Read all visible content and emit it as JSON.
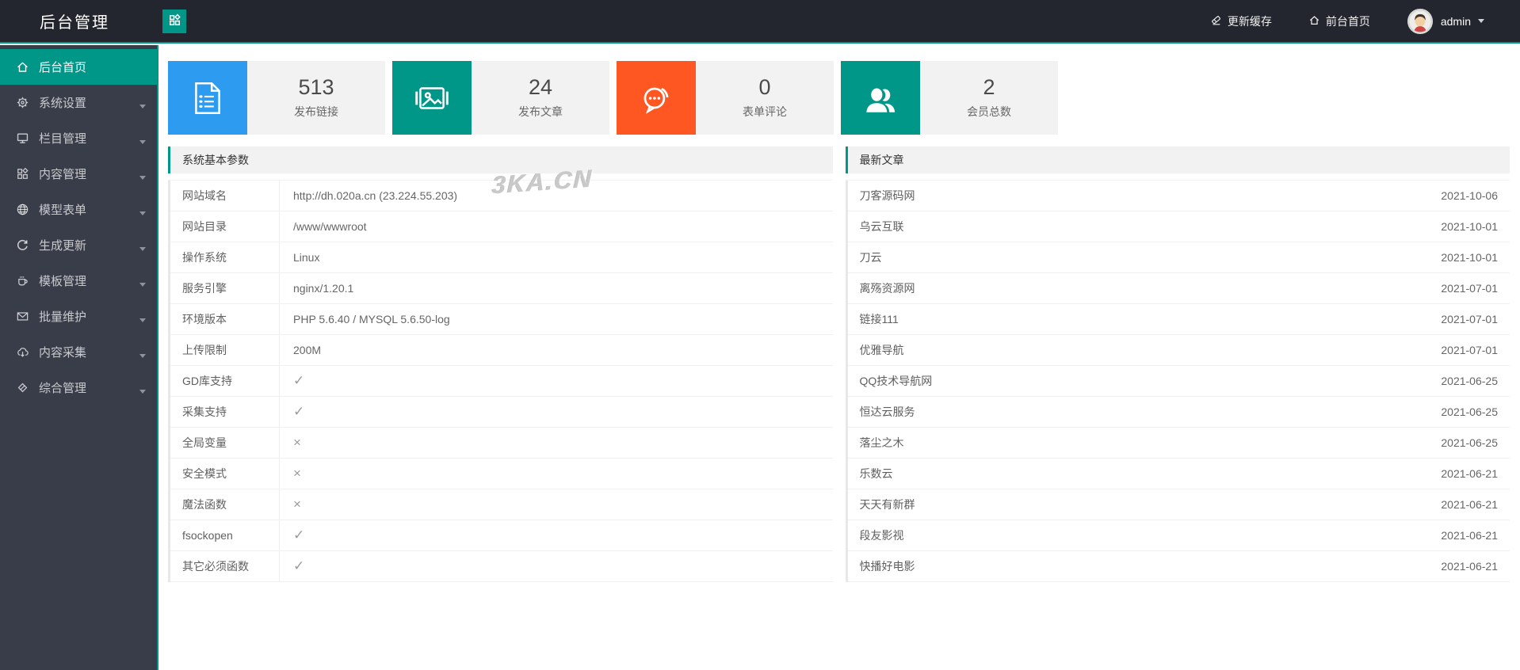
{
  "colors": {
    "accent_teal": "#009688",
    "topbar_bg": "#23262e",
    "sidebar_bg": "#393d49",
    "stat_blue": "#2d9bf0",
    "stat_orange": "#ff5722",
    "panel_gray": "#f2f2f2"
  },
  "header": {
    "title": "后台管理",
    "refresh_cache_label": "更新缓存",
    "front_home_label": "前台首页",
    "username": "admin"
  },
  "sidebar": {
    "items": [
      {
        "key": "dashboard",
        "label": "后台首页",
        "icon": "home-icon",
        "active": true,
        "has_submenu": false
      },
      {
        "key": "system",
        "label": "系统设置",
        "icon": "gear-icon",
        "active": false,
        "has_submenu": true
      },
      {
        "key": "columns",
        "label": "栏目管理",
        "icon": "monitor-icon",
        "active": false,
        "has_submenu": true
      },
      {
        "key": "content",
        "label": "内容管理",
        "icon": "grid-icon",
        "active": false,
        "has_submenu": true
      },
      {
        "key": "model-form",
        "label": "模型表单",
        "icon": "globe-icon",
        "active": false,
        "has_submenu": true
      },
      {
        "key": "generate",
        "label": "生成更新",
        "icon": "refresh-icon",
        "active": false,
        "has_submenu": true
      },
      {
        "key": "templates",
        "label": "模板管理",
        "icon": "cup-icon",
        "active": false,
        "has_submenu": true
      },
      {
        "key": "batch",
        "label": "批量维护",
        "icon": "mail-icon",
        "active": false,
        "has_submenu": true
      },
      {
        "key": "collect",
        "label": "内容采集",
        "icon": "cloud-download-icon",
        "active": false,
        "has_submenu": true
      },
      {
        "key": "misc",
        "label": "综合管理",
        "icon": "diamond-icon",
        "active": false,
        "has_submenu": true
      }
    ]
  },
  "stats": [
    {
      "key": "links",
      "value": "513",
      "label": "发布链接",
      "icon": "document-icon",
      "color": "#2d9bf0"
    },
    {
      "key": "articles",
      "value": "24",
      "label": "发布文章",
      "icon": "image-icon",
      "color": "#009688"
    },
    {
      "key": "comments",
      "value": "0",
      "label": "表单评论",
      "icon": "chat-icon",
      "color": "#ff5722"
    },
    {
      "key": "members",
      "value": "2",
      "label": "会员总数",
      "icon": "users-icon",
      "color": "#009688"
    }
  ],
  "system_panel": {
    "title": "系统基本参数",
    "rows": [
      {
        "label": "网站域名",
        "value": "http://dh.020a.cn (23.224.55.203)"
      },
      {
        "label": "网站目录",
        "value": "/www/wwwroot"
      },
      {
        "label": "操作系统",
        "value": "Linux"
      },
      {
        "label": "服务引擎",
        "value": "nginx/1.20.1"
      },
      {
        "label": "环境版本",
        "value": "PHP 5.6.40 / MYSQL 5.6.50-log"
      },
      {
        "label": "上传限制",
        "value": "200M"
      },
      {
        "label": "GD库支持",
        "value": "✓"
      },
      {
        "label": "采集支持",
        "value": "✓"
      },
      {
        "label": "全局变量",
        "value": "×"
      },
      {
        "label": "安全模式",
        "value": "×"
      },
      {
        "label": "魔法函数",
        "value": "×"
      },
      {
        "label": "fsockopen",
        "value": "✓"
      },
      {
        "label": "其它必须函数",
        "value": "✓"
      }
    ]
  },
  "articles_panel": {
    "title": "最新文章",
    "rows": [
      {
        "title": "刀客源码网",
        "date": "2021-10-06"
      },
      {
        "title": "乌云互联",
        "date": "2021-10-01"
      },
      {
        "title": "刀云",
        "date": "2021-10-01"
      },
      {
        "title": "离殇资源网",
        "date": "2021-07-01"
      },
      {
        "title": "链接111",
        "date": "2021-07-01"
      },
      {
        "title": "优雅导航",
        "date": "2021-07-01"
      },
      {
        "title": "QQ技术导航网",
        "date": "2021-06-25"
      },
      {
        "title": "恒达云服务",
        "date": "2021-06-25"
      },
      {
        "title": "落尘之木",
        "date": "2021-06-25"
      },
      {
        "title": "乐数云",
        "date": "2021-06-21"
      },
      {
        "title": "天天有新群",
        "date": "2021-06-21"
      },
      {
        "title": "段友影视",
        "date": "2021-06-21"
      },
      {
        "title": "快播好电影",
        "date": "2021-06-21"
      }
    ]
  },
  "watermark": "3KA.CN"
}
